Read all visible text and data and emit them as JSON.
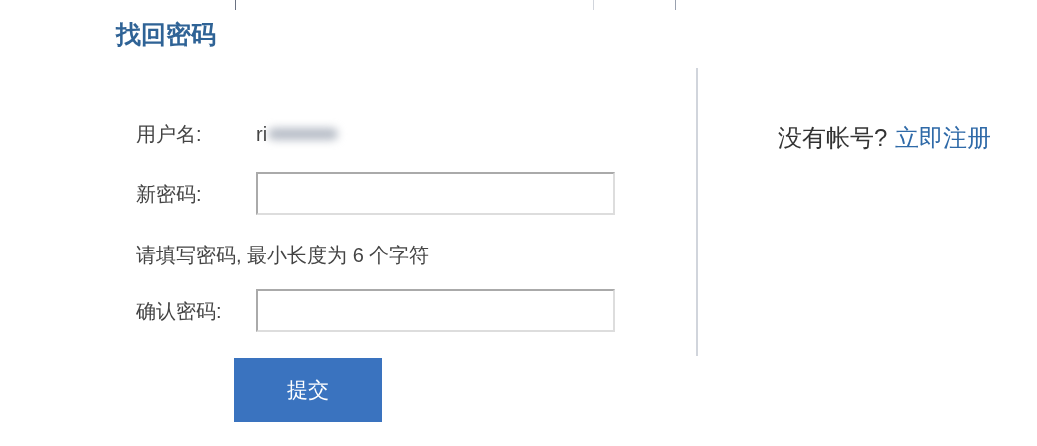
{
  "title": "找回密码",
  "form": {
    "username_label": "用户名:",
    "username_value": "ri",
    "fields": [
      {
        "label": "新密码:",
        "hint": "请填写密码, 最小长度为 6 个字符"
      },
      {
        "label": "确认密码:"
      }
    ],
    "submit": "提交"
  },
  "side": {
    "prompt": "没有帐号?",
    "link": "立即注册"
  }
}
